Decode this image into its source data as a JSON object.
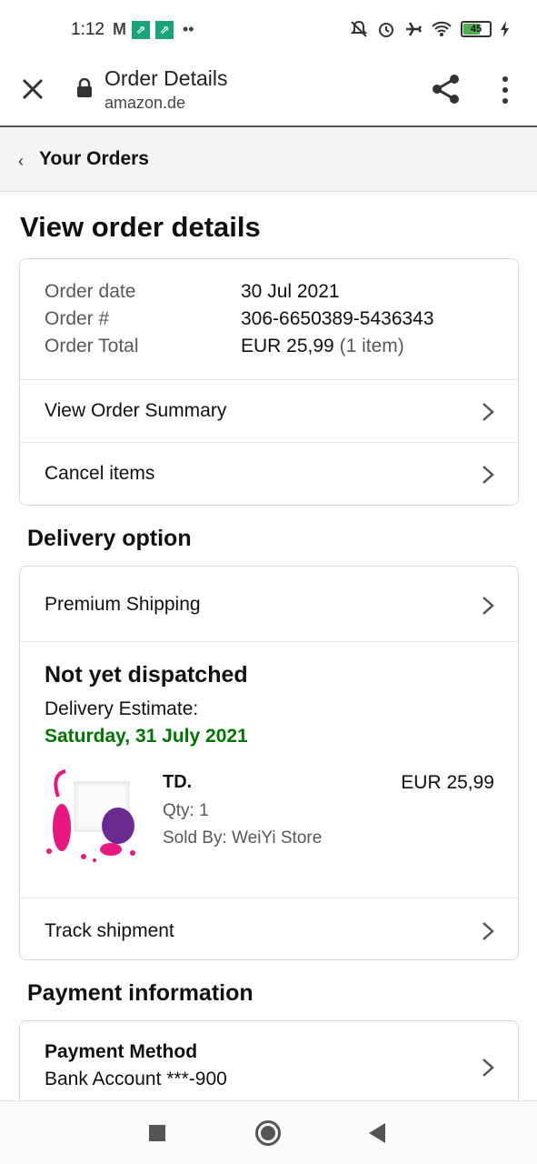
{
  "status_bar": {
    "time": "1:12",
    "battery": "45"
  },
  "browser": {
    "title": "Order Details",
    "url": "amazon.de"
  },
  "breadcrumb": {
    "label": "Your Orders"
  },
  "page": {
    "title": "View order details"
  },
  "order": {
    "date_label": "Order date",
    "date_value": "30 Jul 2021",
    "number_label": "Order #",
    "number_value": "306-6650389-5436343",
    "total_label": "Order Total",
    "total_value": "EUR 25,99",
    "total_items": "(1 item)",
    "summary_link": "View Order Summary",
    "cancel_link": "Cancel items"
  },
  "delivery": {
    "section_title": "Delivery option",
    "option": "Premium Shipping",
    "status": "Not yet dispatched",
    "estimate_label": "Delivery Estimate:",
    "estimate_date": "Saturday, 31 July 2021",
    "item": {
      "title": "TD.",
      "price": "EUR 25,99",
      "qty": "Qty: 1",
      "sold_by": "Sold By: WeiYi Store"
    },
    "track_link": "Track shipment"
  },
  "payment": {
    "section_title": "Payment information",
    "method_title": "Payment Method",
    "method_value": "Bank Account ***-900"
  },
  "colors": {
    "estimate_green": "#007600",
    "product_pink": "#e8177f",
    "product_purple": "#6b2a8f"
  }
}
